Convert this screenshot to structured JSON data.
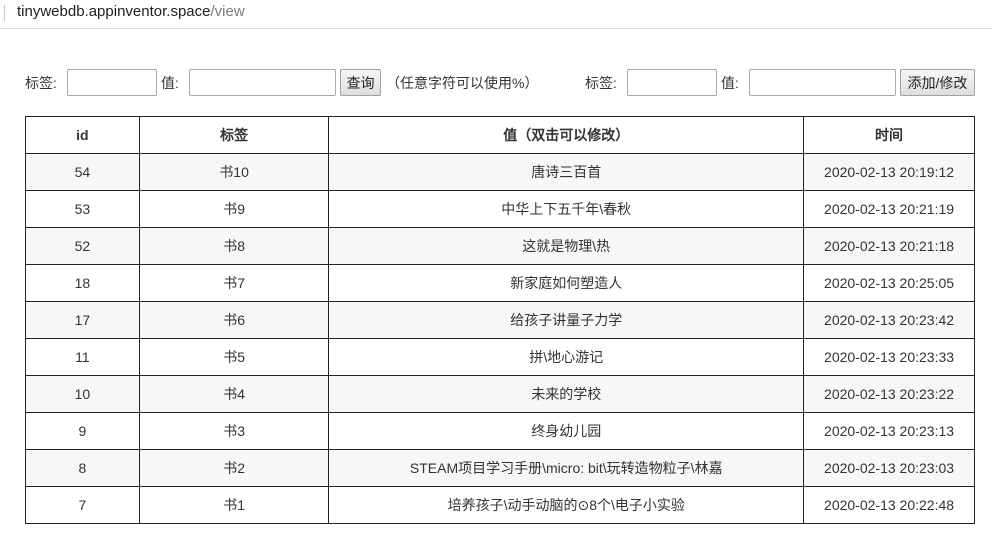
{
  "browser": {
    "url_host": "tinywebdb.appinventor.space",
    "url_path": "/view"
  },
  "search_form": {
    "tag_label": "标签:",
    "tag_value": "",
    "value_label": "值:",
    "value_value": "",
    "query_button": "查询",
    "hint": "（任意字符可以使用%）"
  },
  "edit_form": {
    "tag_label": "标签:",
    "tag_value": "",
    "value_label": "值:",
    "value_value": "",
    "submit_button": "添加/修改"
  },
  "table": {
    "headers": {
      "id": "id",
      "tag": "标签",
      "value": "值（双击可以修改）",
      "time": "时间"
    },
    "rows": [
      {
        "id": "54",
        "tag": "书10",
        "value": "唐诗三百首",
        "time": "2020-02-13 20:19:12"
      },
      {
        "id": "53",
        "tag": "书9",
        "value": "中华上下五千年\\春秋",
        "time": "2020-02-13 20:21:19"
      },
      {
        "id": "52",
        "tag": "书8",
        "value": "这就是物理\\热",
        "time": "2020-02-13 20:21:18"
      },
      {
        "id": "18",
        "tag": "书7",
        "value": "新家庭如何塑造人",
        "time": "2020-02-13 20:25:05"
      },
      {
        "id": "17",
        "tag": "书6",
        "value": "给孩子讲量子力学",
        "time": "2020-02-13 20:23:42"
      },
      {
        "id": "11",
        "tag": "书5",
        "value": "拼\\地心游记",
        "time": "2020-02-13 20:23:33"
      },
      {
        "id": "10",
        "tag": "书4",
        "value": "未来的学校",
        "time": "2020-02-13 20:23:22"
      },
      {
        "id": "9",
        "tag": "书3",
        "value": "终身幼儿园",
        "time": "2020-02-13 20:23:13"
      },
      {
        "id": "8",
        "tag": "书2",
        "value": "STEAM项目学习手册\\micro: bit\\玩转造物粒子\\林嘉",
        "time": "2020-02-13 20:23:03"
      },
      {
        "id": "7",
        "tag": "书1",
        "value": "培养孩子\\动手动脑的⊙8个\\电子小实验",
        "time": "2020-02-13 20:22:48"
      }
    ]
  }
}
